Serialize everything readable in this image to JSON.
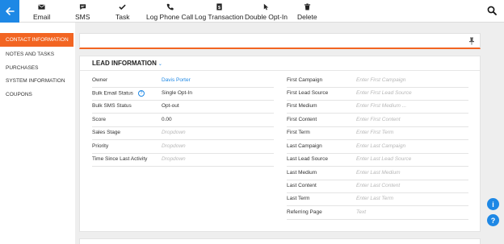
{
  "toolbar": {
    "email": "Email",
    "sms": "SMS",
    "task": "Task",
    "log_phone_call": "Log Phone Call",
    "log_transaction": "Log Transaction",
    "double_opt_in": "Double Opt-In",
    "delete": "Delete"
  },
  "sidebar": {
    "items": [
      {
        "label": "CONTACT INFORMATION",
        "active": true
      },
      {
        "label": "NOTES AND TASKS"
      },
      {
        "label": "PURCHASES"
      },
      {
        "label": "SYSTEM INFORMATION"
      },
      {
        "label": "COUPONS"
      }
    ]
  },
  "card": {
    "title": "LEAD INFORMATION",
    "caret": "⌄"
  },
  "left_fields": [
    {
      "label": "Owner",
      "value": "Davis Porter"
    },
    {
      "label": "Bulk Email Status",
      "help": "?",
      "value": "Single Opt-In"
    },
    {
      "label": "Bulk SMS Status",
      "value": "Opt-out"
    },
    {
      "label": "Score",
      "value": "0.00"
    },
    {
      "label": "Sales Stage",
      "value": "Dropdown"
    },
    {
      "label": "Priority",
      "value": "Dropdown"
    },
    {
      "label": "Time Since Last Activity",
      "value": "Dropdown"
    }
  ],
  "right_fields": [
    {
      "label": "First Campaign",
      "value": "Enter First Campaign"
    },
    {
      "label": "First Lead Source",
      "value": "Enter First Lead Source"
    },
    {
      "label": "First Medium",
      "value": "Enter First Medium ..."
    },
    {
      "label": "First Content",
      "value": "Enter First Content"
    },
    {
      "label": "First Term",
      "value": "Enter First Term"
    },
    {
      "label": "Last Campaign",
      "value": "Enter Last Campaign"
    },
    {
      "label": "Last Lead Source",
      "value": "Enter Last Lead Source"
    },
    {
      "label": "Last Medium",
      "value": "Enter Last Medium"
    },
    {
      "label": "Last Content",
      "value": "Enter Last Content"
    },
    {
      "label": "Last Term",
      "value": "Enter Last Term"
    },
    {
      "label": "Referring Page",
      "value": "Text"
    }
  ],
  "fab": {
    "info": "i",
    "help": "?"
  },
  "colors": {
    "accent": "#1e88e5",
    "active": "#f26522",
    "background": "#eeeeee"
  },
  "icons": [
    "back-arrow-icon",
    "email-icon",
    "sms-icon",
    "check-icon",
    "phone-icon",
    "transaction-icon",
    "cursor-icon",
    "trash-icon",
    "search-icon",
    "pin-icon",
    "info-icon",
    "help-icon"
  ]
}
